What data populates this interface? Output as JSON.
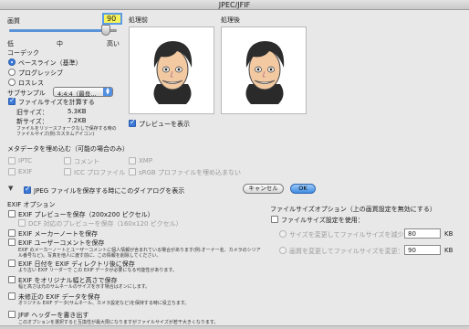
{
  "window": {
    "title": "JPEC/JFIF"
  },
  "quality": {
    "label": "画質",
    "value": "90",
    "low": "低",
    "mid": "中",
    "high": "高い",
    "level": 0.9
  },
  "codec": {
    "label": "コーデック",
    "options": [
      "ベースライン（基準）",
      "プログレッシブ",
      "ロスレス"
    ],
    "selected": 0
  },
  "subsample": {
    "label": "サブサンプル",
    "value": "4:4:4（最良…"
  },
  "filesize": {
    "calc_label": "ファイルサイズを計算する",
    "old_label": "旧サイズ：",
    "old_value": "5.3KB",
    "new_label": "新サイズ：",
    "new_value": "7.2KB",
    "note": "ファイルをリソースフォークなしで保存する時のファイルサイズ(例:カスタムアイコン)"
  },
  "preview": {
    "before_label": "処理前",
    "after_label": "処理後",
    "show_label": "プレビューを表示"
  },
  "metadata": {
    "heading": "メタデータを埋め込む（可能の場合のみ）",
    "items": [
      "IPTC",
      "コメント",
      "XMP",
      "EXIF",
      "ICC プロファイル",
      "sRGB プロファイルを埋め込まない"
    ]
  },
  "dialog_option": {
    "label": "JPEG ファイルを保存する時にこのダイアログを表示"
  },
  "buttons": {
    "cancel": "キャンセル",
    "ok": "OK"
  },
  "exif": {
    "heading": "EXIF オプション",
    "preview_save": "EXIF プレビューを保存（200x200 ピクセル）",
    "dcf_preview": "DCF 対応のプレビューを保存（160x120 ピクセル）",
    "maker_note": "EXIF メーカーノートを保存",
    "user_comment": "EXIF ユーザーコメントを保存",
    "comment_note": "EXIF のメーカーノートとユーザーコメントに個人情報が含まれている場合があります(例:オーナー名、カメラのシリアル番号など)。写真を他人に渡す前に、この情報を削除してください。",
    "date_save": "EXIF 日付を EXIF ディレクトリ後に保存",
    "date_note": "より古い EXIF リーダーで この EXIF データが必要になる可能性があります。",
    "orig_size": "EXIF をオリジナル幅と高さで保存",
    "orig_note": "幅と高さは元のサムネールのサイズを示す場合はオンにします。",
    "unmodified": "未修正の EXIF データを保存",
    "unmodified_note": "オリジナル EXIF データ(サムネール、カメラ設定など)を保持する時に役立ちます。",
    "jfif_header": "JFIF ヘッダーを書き出す",
    "jfif_note": "このオプションを選択すると互換性が最大限になりますがファイルサイズが若干大きくなります。"
  },
  "filesize_option": {
    "heading": "ファイルサイズオプション（上の画質設定を無効にする）",
    "save_label": "ファイルサイズ設定を使用：",
    "reduce_label": "サイズを変更してファイルサイズを減少：",
    "reduce_value": "80",
    "reduce_unit": "KB",
    "change_label": "画質を変更してファイルサイズを変更：",
    "change_value": "90",
    "change_unit": "KB"
  },
  "colors": {
    "accent": "#3a79d8",
    "ok_button": "#4a90e2",
    "title_bar": "#d4d4d4"
  }
}
